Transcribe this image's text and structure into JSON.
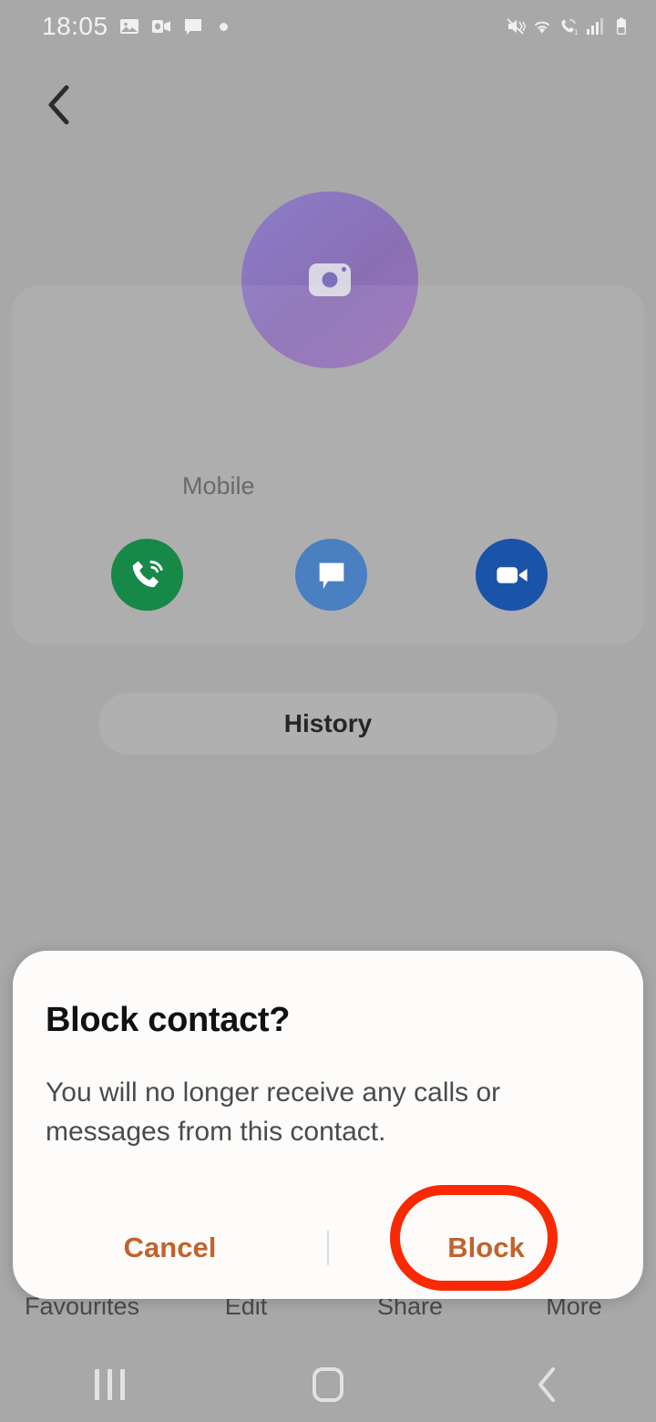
{
  "status_bar": {
    "time": "18:05",
    "left_icons": [
      {
        "name": "gallery-icon"
      },
      {
        "name": "outlook-icon"
      },
      {
        "name": "messages-icon"
      },
      {
        "name": "notification-dot-icon"
      }
    ],
    "right_icons": [
      {
        "name": "mute-vibrate-icon"
      },
      {
        "name": "wifi-icon"
      },
      {
        "name": "wifi-calling-icon"
      },
      {
        "name": "signal-bars-icon"
      },
      {
        "name": "battery-icon"
      }
    ]
  },
  "header": {
    "back_label": "Back"
  },
  "contact": {
    "avatar_icon": "camera-icon",
    "number_label": "Mobile",
    "actions": [
      {
        "name": "call-button",
        "icon": "phone-wifi-calling-icon",
        "color": "#168848"
      },
      {
        "name": "message-button",
        "icon": "chat-bubble-icon",
        "color": "#4a7fc1"
      },
      {
        "name": "video-call-button",
        "icon": "video-camera-icon",
        "color": "#1a53a8"
      }
    ],
    "history_label": "History"
  },
  "bottom_bar": {
    "items": [
      {
        "label": "Favourites"
      },
      {
        "label": "Edit"
      },
      {
        "label": "Share"
      },
      {
        "label": "More"
      }
    ]
  },
  "dialog": {
    "title": "Block contact?",
    "message": "You will no longer receive any calls or messages from this contact.",
    "cancel_label": "Cancel",
    "confirm_label": "Block",
    "accent_color": "#c2622c",
    "highlight_color": "#f72a05",
    "highlighted_button": "Block"
  },
  "nav_bar": {
    "recents_label": "Recents",
    "home_label": "Home",
    "back_label": "Back"
  }
}
